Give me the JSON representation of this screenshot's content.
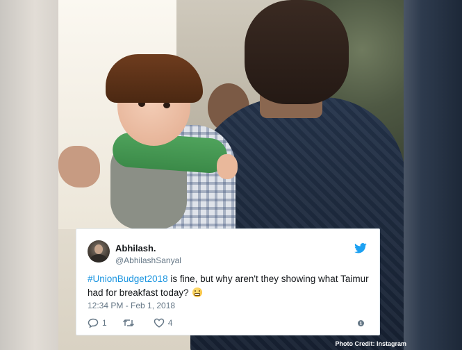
{
  "photo": {
    "credit": "Photo Credit: Instagram"
  },
  "tweet": {
    "display_name": "Abhilash.",
    "handle": "@AbhilashSanyal",
    "brand_icon": "twitter-bird-icon",
    "text_hashtag": "#UnionBudget2018",
    "text_body": " is fine, but why aren't they showing what Taimur had for breakfast today? ",
    "emoji": "grimacing-face-icon",
    "timestamp": "12:34 PM - Feb 1, 2018",
    "actions": {
      "reply_count": "1",
      "retweet_count": "",
      "like_count": "4"
    },
    "colors": {
      "link": "#1b95e0",
      "brand": "#1da1f2",
      "muted": "#657786",
      "text": "#14171a"
    }
  }
}
